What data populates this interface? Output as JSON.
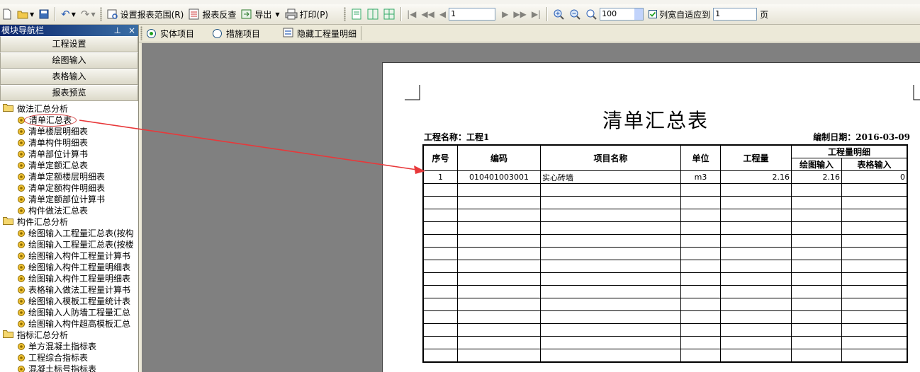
{
  "toolbar": {
    "set_range_label": "设置报表范围(R)",
    "reverse_check_label": "报表反查",
    "export_label": "导出",
    "print_label": "打印(P)",
    "page_input_value": "1",
    "zoom_value": "100",
    "fit_label": "列宽自适应到",
    "fit_pages_value": "1",
    "page_unit": "页"
  },
  "nav": {
    "title": "模块导航栏",
    "pin": "⊥",
    "close": "×",
    "buttons": [
      "工程设置",
      "绘图输入",
      "表格输入",
      "报表预览"
    ],
    "groups": [
      {
        "label": "做法汇总分析",
        "items": [
          "清单汇总表",
          "清单楼层明细表",
          "清单构件明细表",
          "清单部位计算书",
          "清单定额汇总表",
          "清单定额楼层明细表",
          "清单定额构件明细表",
          "清单定额部位计算书",
          "构件做法汇总表"
        ]
      },
      {
        "label": "构件汇总分析",
        "items": [
          "绘图输入工程量汇总表(按构",
          "绘图输入工程量汇总表(按楼",
          "绘图输入构件工程量计算书",
          "绘图输入构件工程量明细表",
          "绘图输入构件工程量明细表",
          "表格输入做法工程量计算书",
          "绘图输入模板工程量统计表",
          "绘图输入人防墙工程量汇总",
          "绘图输入构件超高模板汇总"
        ]
      },
      {
        "label": "指标汇总分析",
        "items": [
          "单方混凝土指标表",
          "工程综合指标表",
          "混凝土标号指标表"
        ]
      }
    ]
  },
  "tabs": {
    "solid_label": "实体项目",
    "measure_label": "措施项目",
    "hide_label": "隐藏工程量明细"
  },
  "report": {
    "title": "清单汇总表",
    "project": "工程名称：工程1",
    "date": "编制日期：2016-03-09",
    "headers": {
      "seq": "序号",
      "code": "编码",
      "name": "项目名称",
      "unit": "单位",
      "qty": "工程量",
      "detail": "工程量明细",
      "draw": "绘图输入",
      "table": "表格输入"
    },
    "rows": [
      [
        "1",
        "010401003001",
        "实心砖墙",
        "m3",
        "2.16",
        "2.16",
        "0"
      ]
    ]
  },
  "colors": {
    "accent_red": "#e8383a",
    "title_bar": "#0a246a",
    "workspace": "#808080"
  }
}
